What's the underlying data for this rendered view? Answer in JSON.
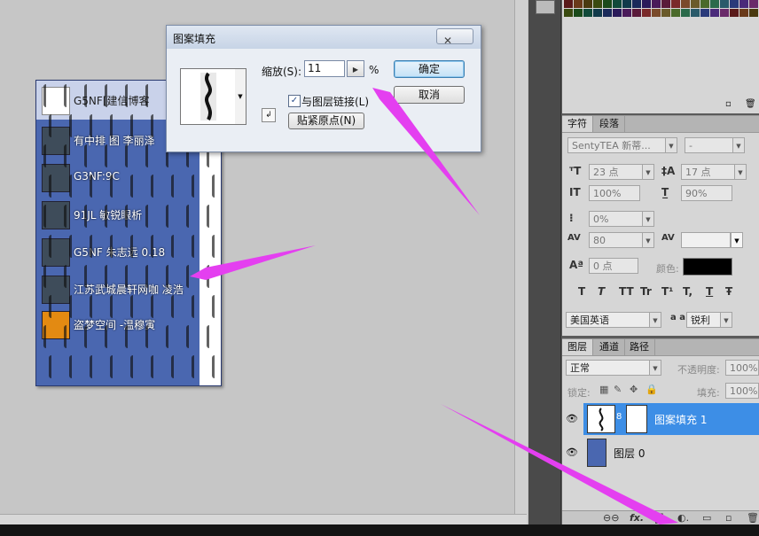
{
  "dialog": {
    "title": "图案填充",
    "close_label": "✕",
    "scale_label": "缩放(S):",
    "scale_value": "11",
    "scale_unit": "%",
    "link_label": "与图层链接(L)",
    "link_checked": "✓",
    "snap_label": "贴紧原点(N)",
    "ok_label": "确定",
    "cancel_label": "取消"
  },
  "document": {
    "rows": [
      {
        "label": "G5NF[建信博客"
      },
      {
        "label": "有中排 图 李丽泽"
      },
      {
        "label": "G3NF:9C"
      },
      {
        "label": "91JL 敏锐眼析"
      },
      {
        "label": "G5NF 朱志远 0.18"
      },
      {
        "label": "江苏武城晨轩网咖 凌浩"
      },
      {
        "label": "盗梦空间 -温穆寅"
      }
    ]
  },
  "character_panel": {
    "tabs": [
      "字符",
      "段落"
    ],
    "font_family": "SentyTEA 新蒂...",
    "font_style": "-",
    "font_size": "23 点",
    "leading": "17 点",
    "vertical_scale": "100%",
    "horizontal_scale": "90%",
    "tracking_ratio": "0%",
    "tracking": "80",
    "baseline_shift": "0 点",
    "color_label": "颜色:",
    "language": "美国英语",
    "aa_label": "a a",
    "antialias": "锐利",
    "style_buttons": [
      "T",
      "T",
      "TT",
      "Tr",
      "T¹",
      "T,",
      "T",
      "Ŧ"
    ]
  },
  "layers_panel": {
    "tabs": [
      "图层",
      "通道",
      "路径"
    ],
    "blend_mode": "正常",
    "opacity_label": "不透明度:",
    "opacity_value": "100%",
    "lock_label": "锁定:",
    "fill_label": "填充:",
    "fill_value": "100%",
    "layers": [
      {
        "name": "图案填充 1",
        "selected": true
      },
      {
        "name": "图层 0",
        "selected": false
      }
    ]
  },
  "colors": {
    "selected_layer": "#3d8ee6",
    "doc_blue": "#4a67b0",
    "arrow": "#e43ff0"
  }
}
